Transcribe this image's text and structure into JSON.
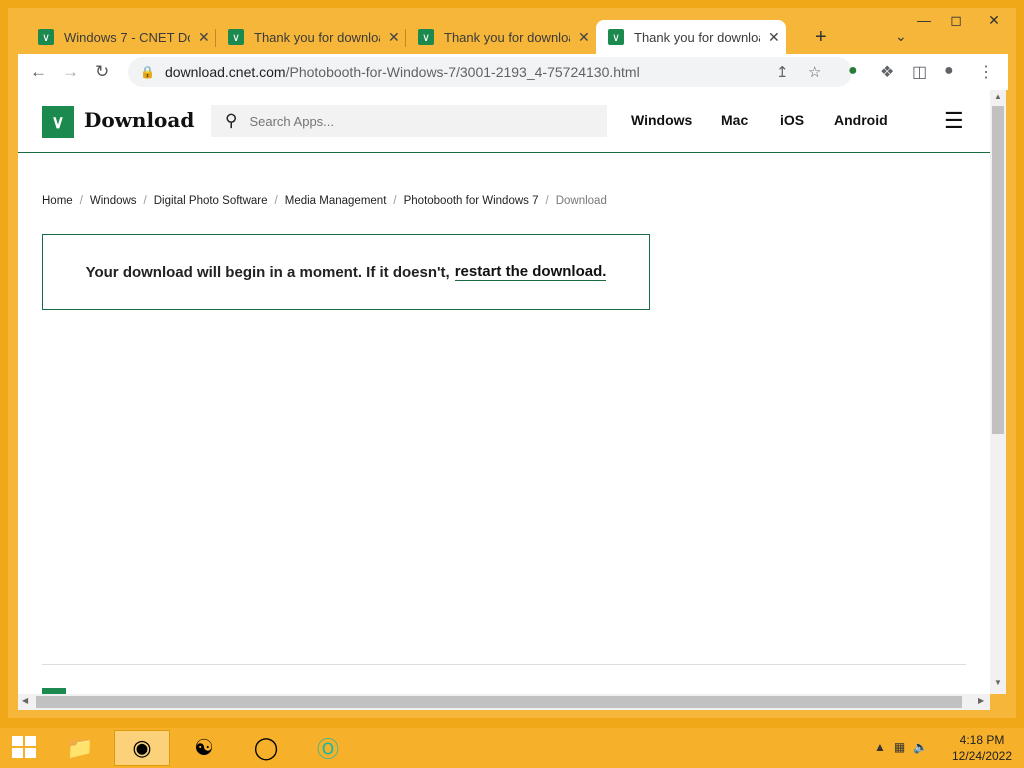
{
  "browser": {
    "tabs": [
      {
        "title": "Windows 7 - CNET Dow",
        "active": false
      },
      {
        "title": "Thank you for downloa",
        "active": false
      },
      {
        "title": "Thank you for downloa",
        "active": false
      },
      {
        "title": "Thank you for downloa",
        "active": true
      }
    ],
    "new_tab_symbol": "+",
    "url_host": "download.cnet.com",
    "url_path": "/Photobooth-for-Windows-7/3001-2193_4-75724130.html"
  },
  "site": {
    "logo_text": "Download",
    "search_placeholder": "Search Apps...",
    "nav": [
      "Windows",
      "Mac",
      "iOS",
      "Android"
    ]
  },
  "breadcrumb": [
    "Home",
    "Windows",
    "Digital Photo Software",
    "Media Management",
    "Photobooth for Windows 7",
    "Download"
  ],
  "notice": {
    "text": "Your download will begin in a moment. If it doesn't,",
    "link": "restart the download."
  },
  "taskbar": {
    "time": "4:18 PM",
    "date": "12/24/2022"
  },
  "colors": {
    "brand_green": "#1c8a4e",
    "desktop_orange": "#f0a818"
  }
}
